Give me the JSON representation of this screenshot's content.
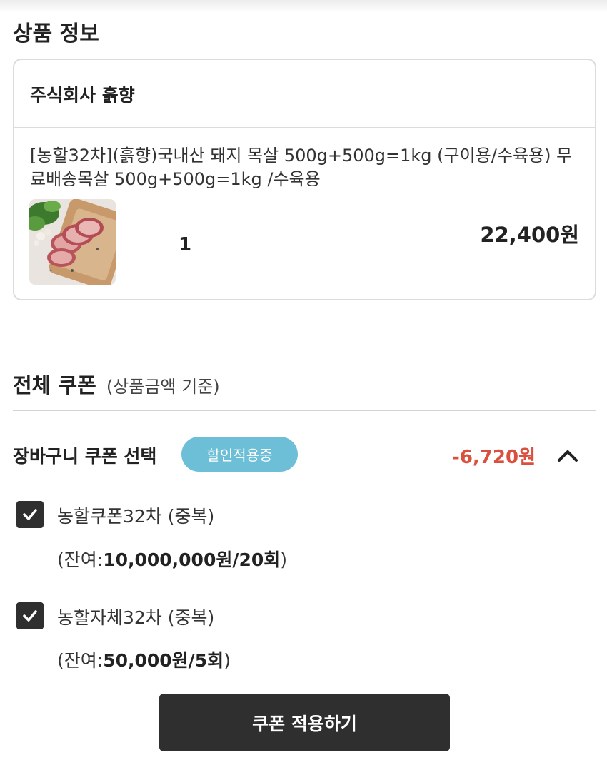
{
  "product_info": {
    "title": "상품 정보",
    "seller": "주식회사 흙향",
    "product_name": "[농할32차](흙향)국내산 돼지 목살 500g+500g=1kg (구이용/수육용) 무료배송목살 500g+500g=1kg /수육용",
    "quantity": "1",
    "price": "22,400원"
  },
  "coupons": {
    "title": "전체 쿠폰",
    "subtitle": "(상품금액 기준)",
    "cart_coupon_label": "장바구니 쿠폰 선택",
    "badge": "할인적용중",
    "discount": "-6,720원",
    "items": [
      {
        "checked": true,
        "name": "농할쿠폰32차 (중복)",
        "remaining_prefix": "(잔여:",
        "remaining_value": "10,000,000원/20회",
        "remaining_suffix": ")"
      },
      {
        "checked": true,
        "name": "농할자체32차 (중복)",
        "remaining_prefix": "(잔여:",
        "remaining_value": "50,000원/5회",
        "remaining_suffix": ")"
      }
    ],
    "apply_label": "쿠폰 적용하기"
  },
  "colors": {
    "badge_bg": "#6cbfd6",
    "discount_text": "#d9513e",
    "button_bg": "#2f2f2f"
  },
  "icons": {
    "toggle": "chevron-up-icon",
    "check": "check-icon"
  }
}
